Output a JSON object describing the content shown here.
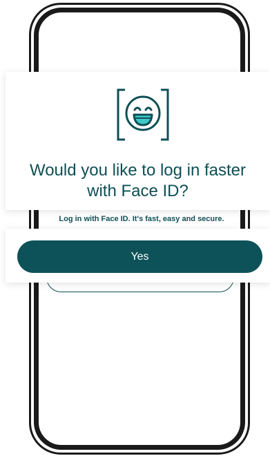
{
  "colors": {
    "brand": "#0d5259",
    "heading": "#0e4f55",
    "phone_frame": "#1a1a1a"
  },
  "icon": "face-id-smile-icon",
  "heading": {
    "line1": "Would you like to log in faster",
    "line2": "with Face ID?"
  },
  "subtext": "Log in with Face ID. It's fast, easy and secure.",
  "primary_button": {
    "label": "Yes"
  }
}
